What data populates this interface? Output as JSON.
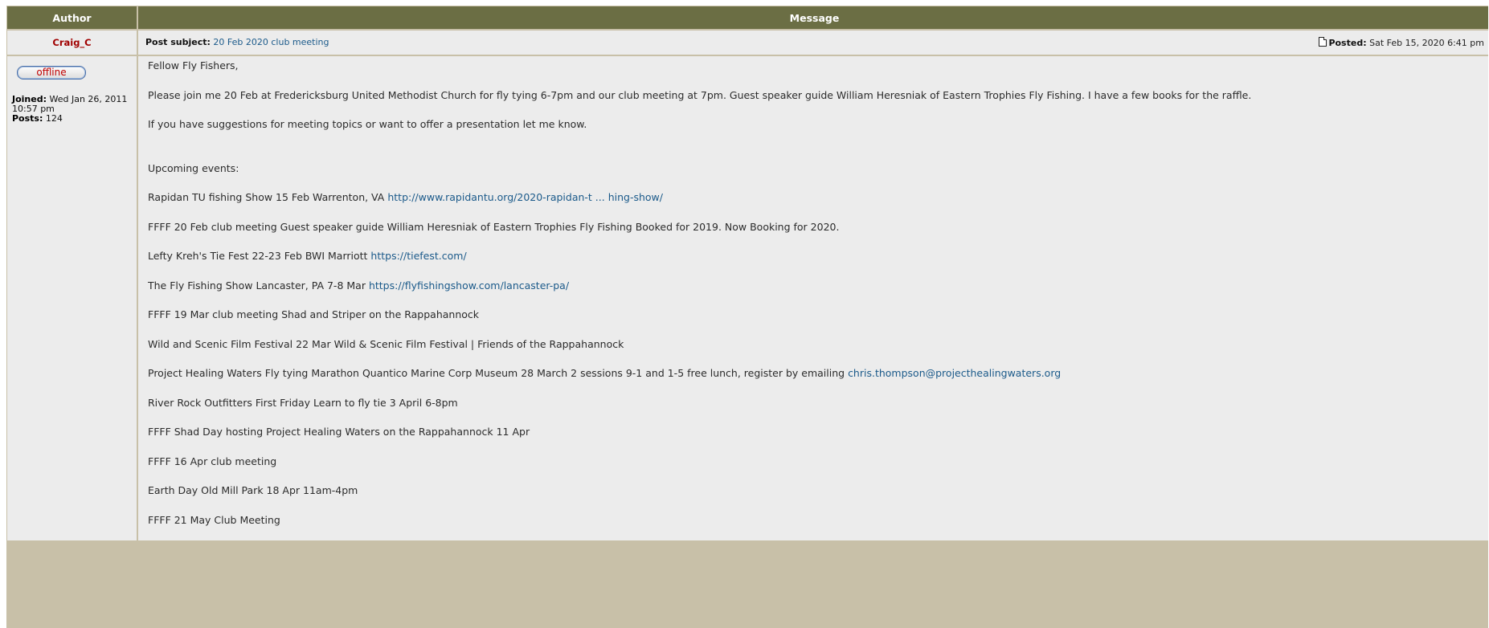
{
  "header": {
    "author": "Author",
    "message": "Message"
  },
  "post": {
    "author": "Craig_C",
    "subject_label": "Post subject:",
    "subject": "20 Feb 2020 club meeting",
    "posted_label": "Posted:",
    "posted": "Sat Feb 15, 2020 6:41 pm",
    "status": "offline",
    "joined_label": "Joined:",
    "joined": "Wed Jan 26, 2011 10:57 pm",
    "posts_label": "Posts:",
    "posts": "124"
  },
  "message": {
    "greeting": "Fellow Fly Fishers,",
    "intro": "Please join me 20 Feb at Fredericksburg United Methodist Church for fly tying 6-7pm and our club meeting at 7pm. Guest speaker guide William Heresniak of Eastern Trophies Fly Fishing. I have a few books for the raffle.",
    "suggest": "If you have suggestions for meeting topics or want to offer a presentation let me know.",
    "upcoming": "Upcoming events:",
    "events": [
      {
        "text": "Rapidan TU fishing Show 15 Feb Warrenton, VA ",
        "link": "http://www.rapidantu.org/2020-rapidan-t ... hing-show/"
      },
      {
        "text": "FFFF 20 Feb club meeting Guest speaker guide William Heresniak of Eastern Trophies Fly Fishing Booked for 2019. Now Booking for 2020.",
        "link": ""
      },
      {
        "text": "Lefty Kreh's Tie Fest 22-23 Feb BWI Marriott ",
        "link": "https://tiefest.com/"
      },
      {
        "text": "The Fly Fishing Show Lancaster, PA 7-8 Mar ",
        "link": "https://flyfishingshow.com/lancaster-pa/"
      },
      {
        "text": "FFFF 19 Mar club meeting Shad and Striper on the Rappahannock",
        "link": ""
      },
      {
        "text": "Wild and Scenic Film Festival 22 Mar Wild & Scenic Film Festival | Friends of the Rappahannock",
        "link": ""
      },
      {
        "text": "Project Healing Waters Fly tying Marathon Quantico Marine Corp Museum 28 March 2 sessions 9-1 and 1-5 free lunch, register by emailing ",
        "link": "chris.thompson@projecthealingwaters.org"
      },
      {
        "text": "River Rock Outfitters First Friday Learn to fly tie 3 April 6-8pm",
        "link": ""
      },
      {
        "text": "FFFF Shad Day hosting Project Healing Waters on the Rappahannock 11 Apr",
        "link": ""
      },
      {
        "text": "FFFF 16 Apr club meeting",
        "link": ""
      },
      {
        "text": "Earth Day Old Mill Park 18 Apr 11am-4pm",
        "link": ""
      },
      {
        "text": "FFFF 21 May Club Meeting",
        "link": ""
      }
    ]
  },
  "colors": {
    "header_bg": "#6b6e44",
    "author_name": "#a00000",
    "link": "#1b5a8a",
    "cell_bg": "#ececec"
  }
}
